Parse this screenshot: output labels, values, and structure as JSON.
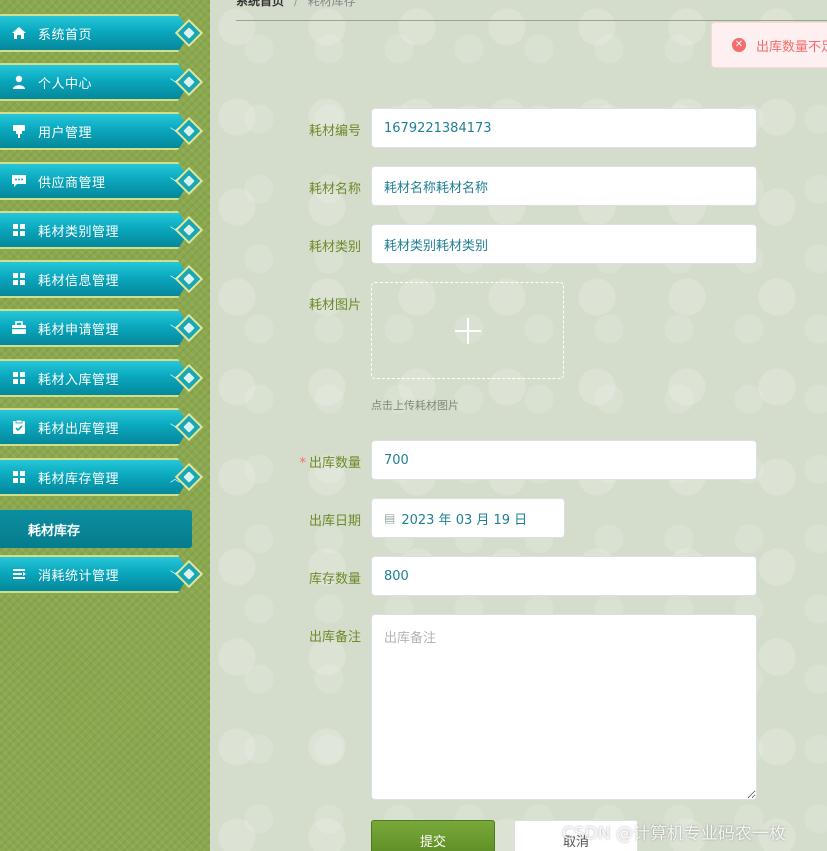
{
  "sidebar": {
    "items": [
      {
        "label": "系统首页",
        "icon": "home-icon",
        "caret": ""
      },
      {
        "label": "个人中心",
        "icon": "user-icon",
        "caret": "﹀"
      },
      {
        "label": "用户管理",
        "icon": "pin-icon",
        "caret": "﹀"
      },
      {
        "label": "供应商管理",
        "icon": "chat-icon",
        "caret": "﹀"
      },
      {
        "label": "耗材类别管理",
        "icon": "grid-icon",
        "caret": "﹀"
      },
      {
        "label": "耗材信息管理",
        "icon": "grid-icon",
        "caret": "﹀"
      },
      {
        "label": "耗材申请管理",
        "icon": "briefcase-icon",
        "caret": "﹀"
      },
      {
        "label": "耗材入库管理",
        "icon": "grid-icon",
        "caret": "﹀"
      },
      {
        "label": "耗材出库管理",
        "icon": "clipboard-icon",
        "caret": "﹀"
      },
      {
        "label": "耗材库存管理",
        "icon": "grid-icon",
        "caret": "︿"
      },
      {
        "label": "消耗统计管理",
        "icon": "list-icon",
        "caret": "﹀"
      }
    ],
    "active_sub": "耗材库存"
  },
  "breadcrumb": {
    "home": "系统首页",
    "separator": "/",
    "current": "耗材库存"
  },
  "toast": {
    "message": "出库数量不足",
    "type": "error"
  },
  "form": {
    "code_label": "耗材编号",
    "code_value": "1679221384173",
    "name_label": "耗材名称",
    "name_value": "耗材名称耗材名称",
    "category_label": "耗材类别",
    "category_value": "耗材类别耗材类别",
    "image_label": "耗材图片",
    "upload_tip": "点击上传耗材图片",
    "out_qty_label": "出库数量",
    "out_qty_required": "*",
    "out_qty_value": "700",
    "out_date_label": "出库日期",
    "out_date_value": "2023 年 03 月 19 日",
    "stock_label": "库存数量",
    "stock_value": "800",
    "remark_label": "出库备注",
    "remark_placeholder": "出库备注",
    "submit_label": "提交",
    "cancel_label": "取消"
  },
  "watermark": "CSDN @计算机专业码农一枚",
  "colors": {
    "menu_teal": "#0aa8be",
    "sidebar_green": "#8ba84e",
    "label_green": "#6d8b2a",
    "submit_green": "#6a9a2e",
    "error_red": "#f56c6c"
  }
}
